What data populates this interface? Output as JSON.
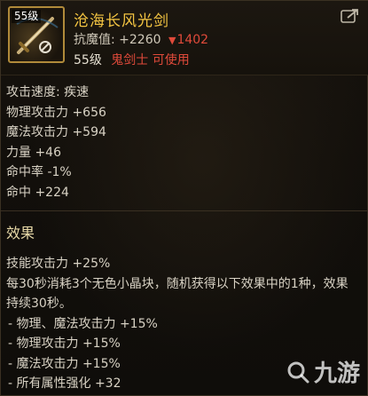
{
  "item": {
    "level_tag": "55级",
    "name": "沧海长风光剑",
    "resist_label": "抗魔值:",
    "resist_value": "+2260",
    "resist_down": "1402",
    "req_level": "55级",
    "req_class": "鬼剑士 可使用"
  },
  "stats": [
    "攻击速度: 疾速",
    "物理攻击力 +656",
    "魔法攻击力 +594",
    "力量 +46",
    "命中率 -1%",
    "命中 +224"
  ],
  "effect": {
    "title": "效果",
    "skill": "技能攻击力 +25%",
    "desc": "每30秒消耗3个无色小晶块，随机获得以下效果中的1种，效果持续30秒。",
    "options": [
      "- 物理、魔法攻击力 +15%",
      "- 物理攻击力 +15%",
      "- 魔法攻击力 +15%",
      "- 所有属性强化 +32"
    ]
  },
  "watermark": {
    "text": "九游"
  },
  "colors": {
    "name": "#f4c542",
    "down": "#e04a3a",
    "class": "#e04a3a",
    "border": "#b08a3a"
  },
  "icons": {
    "share": "share-icon",
    "item": "sword-icon",
    "watermark": "jiuyou-logo-icon"
  }
}
